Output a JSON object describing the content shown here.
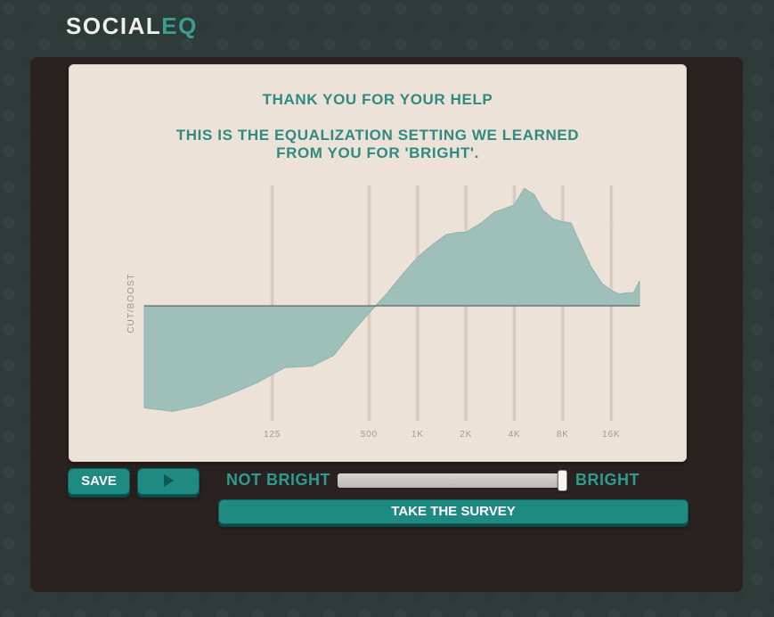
{
  "logo": {
    "part1": "SOCIAL",
    "part2": "EQ"
  },
  "card": {
    "title": "THANK YOU FOR YOUR HELP",
    "message_line1": "THIS IS THE EQUALIZATION SETTING WE LEARNED",
    "message_line2": "FROM YOU FOR 'BRIGHT'."
  },
  "chart_data": {
    "type": "area",
    "ylabel": "CUT/BOOST",
    "xlabel": "",
    "x_scale": "log",
    "x_ticks": [
      "125",
      "500",
      "1K",
      "2K",
      "4K",
      "8K",
      "16K"
    ],
    "x_tick_values": [
      125,
      500,
      1000,
      2000,
      4000,
      8000,
      16000
    ],
    "ylim": [
      -1,
      1
    ],
    "series": [
      {
        "x": [
          20,
          30,
          45,
          70,
          100,
          150,
          220,
          300,
          400,
          500,
          650,
          800,
          1000,
          1250,
          1500,
          1800,
          2000,
          2500,
          3000,
          3500,
          4000,
          4600,
          5300,
          6000,
          7000,
          8000,
          9000,
          10000,
          12000,
          14000,
          16000,
          18000,
          20000,
          22000,
          24000
        ],
        "values": [
          -0.86,
          -0.89,
          -0.84,
          -0.74,
          -0.65,
          -0.52,
          -0.51,
          -0.42,
          -0.21,
          -0.06,
          0.11,
          0.26,
          0.41,
          0.52,
          0.6,
          0.62,
          0.62,
          0.7,
          0.79,
          0.82,
          0.85,
          0.99,
          0.94,
          0.81,
          0.73,
          0.71,
          0.7,
          0.56,
          0.33,
          0.19,
          0.13,
          0.1,
          0.11,
          0.11,
          0.21
        ]
      }
    ]
  },
  "controls": {
    "save_label": "SAVE",
    "play_icon": "play-icon",
    "slider_left_label": "NOT BRIGHT",
    "slider_right_label": "BRIGHT",
    "slider_value": 1.0,
    "survey_label": "TAKE THE SURVEY"
  },
  "colors": {
    "accent": "#2f8a80",
    "button": "#1f8a82",
    "curve_fill": "#9ec0b8",
    "card_bg": "#ece2d8",
    "frame_bg": "#2a2221"
  }
}
